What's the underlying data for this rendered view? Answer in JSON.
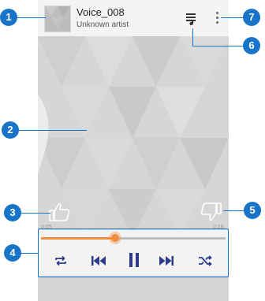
{
  "track": {
    "title": "Voice_008",
    "artist": "Unknown artist"
  },
  "playback": {
    "elapsed": "0:05",
    "total": "0:16",
    "progress_fraction": 0.4
  },
  "icons": {
    "playlist": "playlist-icon",
    "menu": "more-vert-icon",
    "thumb_up": "thumb-up-icon",
    "thumb_down": "thumb-down-icon",
    "repeat": "repeat-icon",
    "previous": "skip-previous-icon",
    "pause": "pause-icon",
    "next": "skip-next-icon",
    "shuffle": "shuffle-icon"
  },
  "callouts": [
    "1",
    "2",
    "3",
    "4",
    "5",
    "6",
    "7"
  ],
  "colors": {
    "accent": "#f08c3a",
    "callout": "#1874c8",
    "artwork": "#d6d6d6"
  }
}
